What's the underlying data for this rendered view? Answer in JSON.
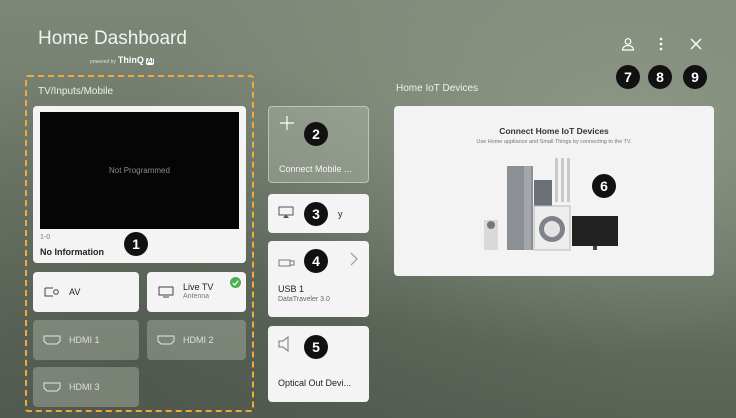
{
  "header": {
    "title": "Home Dashboard",
    "powered_prefix": "powered by",
    "powered_brand": "ThinQ",
    "powered_ai": "AI"
  },
  "top_icons": [
    "account-icon",
    "more-options-icon",
    "close-icon"
  ],
  "inputs": {
    "section_label": "TV/Inputs/Mobile",
    "tv": {
      "screen_text": "Not Programmed",
      "channel": "1-0",
      "info": "No Information"
    },
    "av": "AV",
    "live_tv": {
      "label": "Live TV",
      "sub": "Antenna"
    },
    "hdmi1": "HDMI 1",
    "hdmi2": "HDMI 2",
    "hdmi3": "HDMI 3"
  },
  "mobile": {
    "connect_label": "Connect Mobile ...",
    "airplay_label": "y",
    "usb_label": "USB 1",
    "usb_sub": "DataTraveler 3.0",
    "optical_label": "Optical Out Devi..."
  },
  "iot": {
    "section_label": "Home IoT Devices",
    "heading": "Connect Home IoT Devices",
    "desc": "Use Home appliance and Small Things by connecting to the TV."
  },
  "badges": {
    "b1": "1",
    "b2": "2",
    "b3": "3",
    "b4": "4",
    "b5": "5",
    "b6": "6",
    "b7": "7",
    "b8": "8",
    "b9": "9"
  },
  "colors": {
    "highlight": "#f2a93b",
    "check": "#4caf50",
    "badge": "#111111"
  }
}
